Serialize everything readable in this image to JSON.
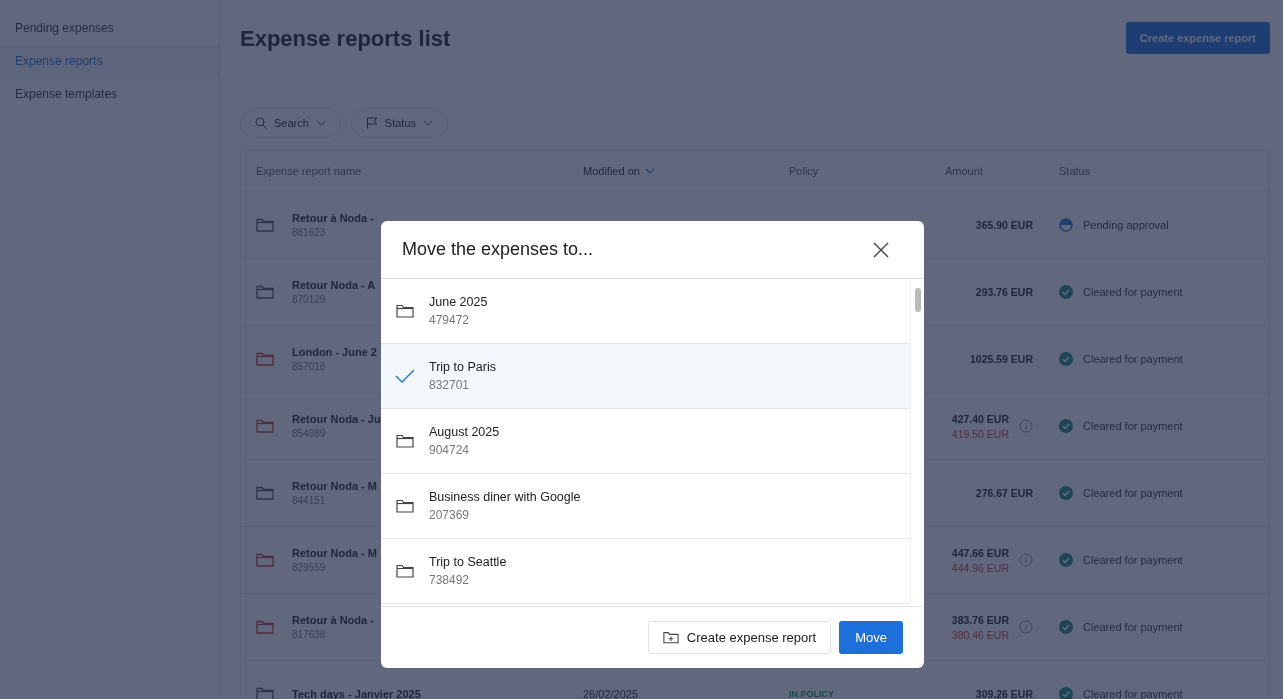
{
  "sidebar": {
    "items": [
      {
        "label": "Pending expenses",
        "selected": false
      },
      {
        "label": "Expense reports",
        "selected": true
      },
      {
        "label": "Expense templates",
        "selected": false
      }
    ]
  },
  "page": {
    "title": "Expense reports list",
    "create_button": "Create expense report"
  },
  "filters": [
    {
      "kind": "search",
      "label": "Search"
    },
    {
      "kind": "flag",
      "label": "Status"
    }
  ],
  "table": {
    "columns": [
      {
        "label": "Expense report name",
        "sorted": false
      },
      {
        "label": "Modified on",
        "sorted": true
      },
      {
        "label": "Policy",
        "sorted": false
      },
      {
        "label": "Amount",
        "sorted": false
      },
      {
        "label": "Status",
        "sorted": false
      }
    ],
    "rows": [
      {
        "name": "Retour à Noda -",
        "id": "881623",
        "warning": false,
        "amount": "365.90 EUR",
        "status": "Pending approval",
        "kind": "pending"
      },
      {
        "name": "Retour Noda - A",
        "id": "870129",
        "warning": false,
        "amount": "293.76 EUR",
        "status": "Cleared for payment",
        "kind": "cleared"
      },
      {
        "name": "London - June 2",
        "id": "857018",
        "warning": true,
        "amount": "1025.59 EUR",
        "status": "Cleared for payment",
        "kind": "cleared"
      },
      {
        "name": "Retour Noda - Ju",
        "id": "854989",
        "warning": true,
        "amount": "427.40 EUR",
        "original_amount": "419.50 EUR",
        "status": "Cleared for payment",
        "kind": "cleared"
      },
      {
        "name": "Retour Noda - M",
        "id": "844151",
        "warning": false,
        "amount": "276.67 EUR",
        "status": "Cleared for payment",
        "kind": "cleared"
      },
      {
        "name": "Retour Noda - M",
        "id": "829559",
        "warning": true,
        "amount": "447.66 EUR",
        "original_amount": "444.96 EUR",
        "status": "Cleared for payment",
        "kind": "cleared"
      },
      {
        "name": "Retour à Noda -",
        "id": "817638",
        "warning": true,
        "amount": "383.76 EUR",
        "original_amount": "380.46 EUR",
        "status": "Cleared for payment",
        "kind": "cleared"
      },
      {
        "name": "Tech days - Janvier 2025",
        "warning": false,
        "modified": "26/02/2025",
        "policy": "IN POLICY",
        "amount": "309.26 EUR",
        "status": "Cleared for payment",
        "kind": "cleared"
      }
    ]
  },
  "dialog": {
    "title": "Move the expenses to...",
    "items": [
      {
        "name": "June 2025",
        "id": "479472",
        "selected": false
      },
      {
        "name": "Trip to Paris",
        "id": "832701",
        "selected": true
      },
      {
        "name": "August 2025",
        "id": "904724",
        "selected": false
      },
      {
        "name": "Business diner with Google",
        "id": "207369",
        "selected": false
      },
      {
        "name": "Trip to Seattle",
        "id": "738492",
        "selected": false
      }
    ],
    "secondary_button": "Create expense report",
    "primary_button": "Move"
  }
}
